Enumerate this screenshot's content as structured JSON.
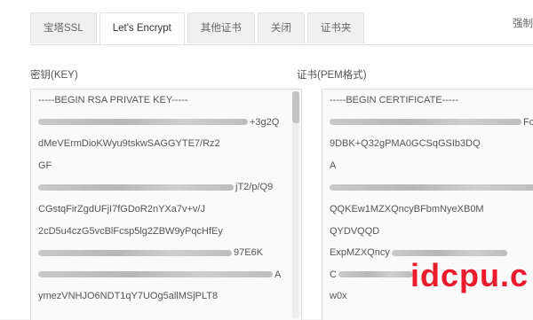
{
  "tabs": [
    {
      "label": "宝塔SSL"
    },
    {
      "label": "Let's Encrypt"
    },
    {
      "label": "其他证书"
    },
    {
      "label": "关闭"
    },
    {
      "label": "证书夹"
    }
  ],
  "top_right_text": "强制",
  "key_label": "密钥(KEY)",
  "cert_label": "证书(PEM格式)",
  "key_lines": [
    "-----BEGIN RSA PRIVATE KEY-----",
    "+3g2Q",
    "dMeVErmDioKWyu9tskwSAGGYTE7/Rz2",
    "GF",
    "jT2/p/Q9",
    "CGstqFirZgdUFjI7fGDoR2nYXa7v+v/J",
    "2cD5u4czG5vcBlFcsp5lg2ZBW9yPqcHfEy",
    "97E6K",
    "A",
    "ymezVNHJO6NDT1qY7UOg5allMSjPLT8"
  ],
  "cert_lines": [
    "-----BEGIN CERTIFICATE-----",
    "Fc",
    "9DBK+Q32gPMA0GCSqGSIb3DQ",
    "A",
    "",
    "QQKEw1MZXQncyBFbmNyeXB0M",
    "QYDVQQD",
    "ExpMZXQncy",
    "C",
    "w0x"
  ],
  "watermark": "idcpu.c"
}
